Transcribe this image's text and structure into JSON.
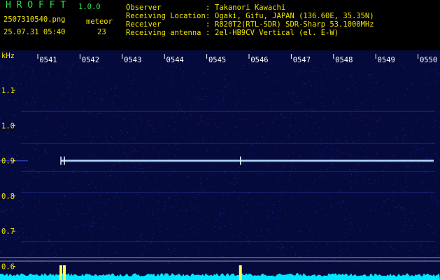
{
  "header": {
    "app_title": "H R O F F T",
    "version": "1.0.0",
    "filename": "2507310540.png",
    "datetime": "25.07.31 05:40",
    "meteor_label": "meteor",
    "meteor_count": "23",
    "info_labels": [
      "Observer",
      "Receiving Location",
      "Receiver",
      "Receiving antenna"
    ],
    "info_colons": [
      ":",
      ":",
      ":",
      ":"
    ],
    "info_values": [
      "Takanori Kawachi",
      "Ogaki, Gifu, JAPAN (136.60E, 35.35N)",
      "R820T2(RTL-SDR) SDR-Sharp 53.1000MHz",
      "2el-HB9CV Vertical (el. E-W)"
    ]
  },
  "chart_data": {
    "type": "heatmap",
    "ylabel": "kHz",
    "x_ticks": [
      "0541",
      "0542",
      "0543",
      "0544",
      "0545",
      "0546",
      "0547",
      "0548",
      "0549",
      "0550"
    ],
    "y_ticks": [
      "1.1",
      "1.0",
      "0.9",
      "0.8",
      "0.7",
      "0.6"
    ],
    "ylim": [
      0.59,
      1.19
    ],
    "carrier_khz": 0.9,
    "carrier_start": "05:41:05",
    "meteor_echo_times": [
      "05:41:05",
      "05:41:10",
      "05:45:20"
    ],
    "colors": {
      "background": "#050a3c",
      "noise": "#2a3cb4",
      "carrier": "#e6f5ff",
      "level_bar": "#00e6ff",
      "level_peak": "#ffff50",
      "axis_text": "#f2e600",
      "x_label": "#ffffff"
    }
  }
}
